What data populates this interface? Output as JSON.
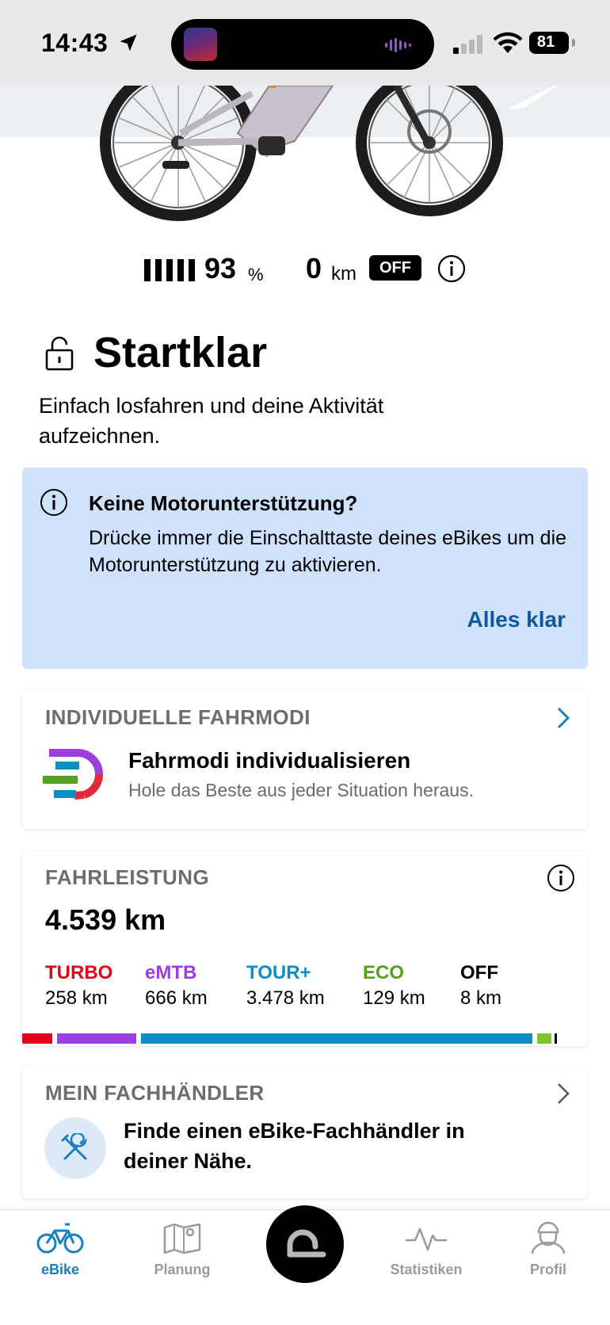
{
  "status_bar": {
    "time": "14:43",
    "battery": "81"
  },
  "bike_status": {
    "battery_percent": "93",
    "percent_unit": "%",
    "range_value": "0",
    "range_unit": "km",
    "mode_badge": "OFF"
  },
  "ready": {
    "title": "Startklar",
    "subtitle": "Einfach losfahren und deine Aktivität aufzeichnen."
  },
  "hint": {
    "title": "Keine Motorunterstützung?",
    "text": "Drücke immer die Einschalttaste deines eBikes um die Motorunterstützung zu aktivieren.",
    "button": "Alles klar"
  },
  "modes_card": {
    "section": "INDIVIDUELLE FAHRMODI",
    "title": "Fahrmodi individualisieren",
    "subtitle": "Hole das Beste aus jeder Situation heraus."
  },
  "performance_card": {
    "section": "FAHRLEISTUNG",
    "total": "4.539 km",
    "modes": [
      {
        "name": "TURBO",
        "km": "258 km",
        "color": "#e2001a"
      },
      {
        "name": "eMTB",
        "km": "666 km",
        "color": "#9b3fe0"
      },
      {
        "name": "TOUR+",
        "km": "3.478 km",
        "color": "#0a8ec5"
      },
      {
        "name": "ECO",
        "km": "129 km",
        "color": "#54a01e"
      },
      {
        "name": "OFF",
        "km": "8 km",
        "color": "#000000"
      }
    ]
  },
  "dealer_card": {
    "section": "MEIN FACHHÄNDLER",
    "text": "Finde einen eBike-Fachhändler in deiner Nähe."
  },
  "tabbar": {
    "items": [
      {
        "label": "eBike",
        "icon": "bike-icon",
        "active": true
      },
      {
        "label": "Planung",
        "icon": "map-icon",
        "active": false
      },
      {
        "label": "Statistiken",
        "icon": "activity-icon",
        "active": false
      },
      {
        "label": "Profil",
        "icon": "profile-icon",
        "active": false
      }
    ]
  },
  "colors": {
    "accent": "#1580c4",
    "hint_bg": "#cfe2fb",
    "link": "#0f5a9c"
  }
}
